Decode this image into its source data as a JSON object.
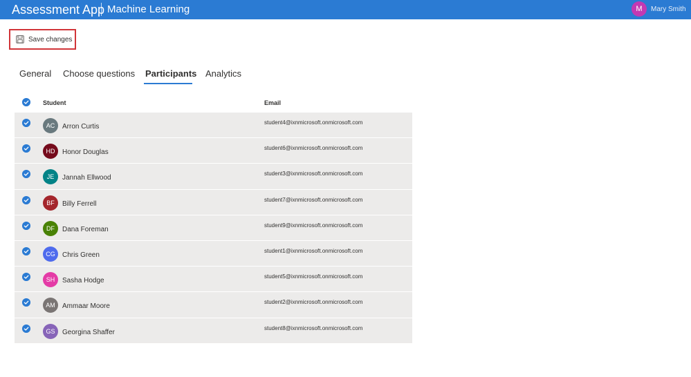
{
  "header": {
    "app_title": "Assessment App",
    "course_title": "Machine Learning",
    "user": {
      "initial": "M",
      "name": "Mary Smith",
      "avatar_color": "#c239b3"
    }
  },
  "toolbar": {
    "save_label": "Save changes",
    "save_icon": "save-icon"
  },
  "tabs": [
    {
      "label": "General",
      "active": false
    },
    {
      "label": "Choose questions",
      "active": false
    },
    {
      "label": "Participants",
      "active": true
    },
    {
      "label": "Analytics",
      "active": false
    }
  ],
  "table": {
    "columns": {
      "student": "Student",
      "email": "Email"
    },
    "select_all_checked": true,
    "rows": [
      {
        "initials": "AC",
        "name": "Arron Curtis",
        "email": "student4@ixnmicrosoft.onmicrosoft.com",
        "color": "#69797e",
        "checked": true
      },
      {
        "initials": "HD",
        "name": "Honor Douglas",
        "email": "student6@ixnmicrosoft.onmicrosoft.com",
        "color": "#750b1c",
        "checked": true
      },
      {
        "initials": "JE",
        "name": "Jannah Ellwood",
        "email": "student3@ixnmicrosoft.onmicrosoft.com",
        "color": "#038387",
        "checked": true
      },
      {
        "initials": "BF",
        "name": "Billy Ferrell",
        "email": "student7@ixnmicrosoft.onmicrosoft.com",
        "color": "#a4262c",
        "checked": true
      },
      {
        "initials": "DF",
        "name": "Dana Foreman",
        "email": "student9@ixnmicrosoft.onmicrosoft.com",
        "color": "#498205",
        "checked": true
      },
      {
        "initials": "CG",
        "name": "Chris Green",
        "email": "student1@ixnmicrosoft.onmicrosoft.com",
        "color": "#4f6bed",
        "checked": true
      },
      {
        "initials": "SH",
        "name": "Sasha Hodge",
        "email": "student5@ixnmicrosoft.onmicrosoft.com",
        "color": "#e43ba6",
        "checked": true
      },
      {
        "initials": "AM",
        "name": "Ammaar Moore",
        "email": "student2@ixnmicrosoft.onmicrosoft.com",
        "color": "#7a7574",
        "checked": true
      },
      {
        "initials": "GS",
        "name": "Georgina Shaffer",
        "email": "student8@ixnmicrosoft.onmicrosoft.com",
        "color": "#8764b8",
        "checked": true
      }
    ]
  },
  "colors": {
    "accent": "#2b7bd3",
    "row_background": "#ecebea",
    "highlight_border": "#d13438"
  }
}
